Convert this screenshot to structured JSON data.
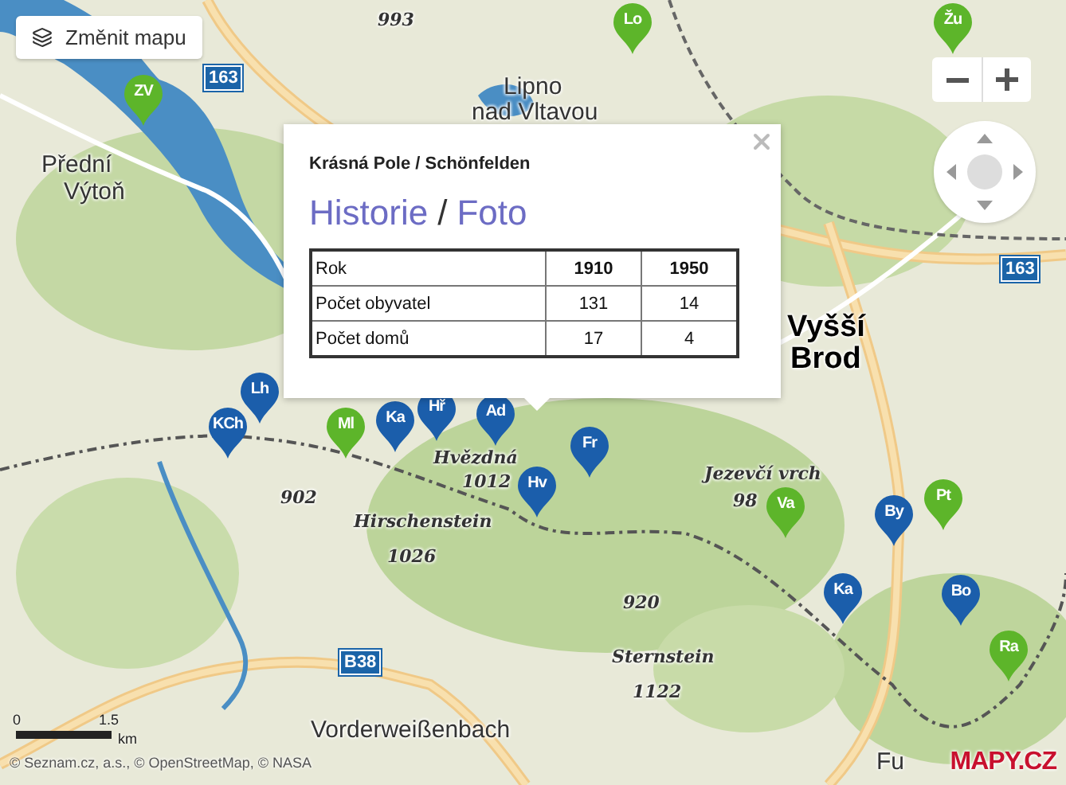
{
  "map_controls": {
    "change_map": "Změnit mapu"
  },
  "popup": {
    "title": "Krásná Pole / Schönfelden",
    "links": [
      "Historie",
      "Foto"
    ],
    "separator": "/",
    "table": {
      "columns": [
        "Rok",
        "1910",
        "1950"
      ],
      "rows": [
        [
          "Počet obyvatel",
          "131",
          "14"
        ],
        [
          "Počet domů",
          "17",
          "4"
        ]
      ]
    }
  },
  "map_labels": [
    {
      "text": "993",
      "kind": "height"
    },
    {
      "text": "Lipno",
      "kind": "town"
    },
    {
      "text": "nad Vltavou",
      "kind": "town"
    },
    {
      "text": "Přední",
      "kind": "town"
    },
    {
      "text": "Výtoň",
      "kind": "town"
    },
    {
      "text": "Vyšší",
      "kind": "city"
    },
    {
      "text": "Brod",
      "kind": "city"
    },
    {
      "text": "Hvězdná",
      "kind": "peak"
    },
    {
      "text": "1012",
      "kind": "height"
    },
    {
      "text": "902",
      "kind": "height"
    },
    {
      "text": "Hirschenstein",
      "kind": "peak"
    },
    {
      "text": "1026",
      "kind": "height"
    },
    {
      "text": "920",
      "kind": "height"
    },
    {
      "text": "Jezevčí vrch",
      "kind": "peak"
    },
    {
      "text": "98",
      "kind": "height"
    },
    {
      "text": "Sternstein",
      "kind": "peak"
    },
    {
      "text": "1122",
      "kind": "height"
    },
    {
      "text": "Vorderweißenbach",
      "kind": "town"
    },
    {
      "text": "Fu",
      "kind": "town"
    }
  ],
  "road_shields": [
    "163",
    "163",
    "B38"
  ],
  "markers": [
    {
      "label": "Lo",
      "color": "#5db52a"
    },
    {
      "label": "Žu",
      "color": "#5db52a"
    },
    {
      "label": "ZV",
      "color": "#5db52a"
    },
    {
      "label": "Lh",
      "color": "#1b5eab"
    },
    {
      "label": "KCh",
      "color": "#1b5eab"
    },
    {
      "label": "Ka",
      "color": "#1b5eab"
    },
    {
      "label": "Hř",
      "color": "#1b5eab"
    },
    {
      "label": "Ml",
      "color": "#5db52a"
    },
    {
      "label": "Ad",
      "color": "#1b5eab"
    },
    {
      "label": "Fr",
      "color": "#1b5eab"
    },
    {
      "label": "Hv",
      "color": "#1b5eab"
    },
    {
      "label": "Va",
      "color": "#5db52a"
    },
    {
      "label": "By",
      "color": "#1b5eab"
    },
    {
      "label": "Pt",
      "color": "#5db52a"
    },
    {
      "label": "Ka",
      "color": "#1b5eab"
    },
    {
      "label": "Bo",
      "color": "#1b5eab"
    },
    {
      "label": "Ra",
      "color": "#5db52a"
    }
  ],
  "scale": {
    "start": "0",
    "end": "1.5",
    "unit": "km"
  },
  "attribution": "© Seznam.cz, a.s., © OpenStreetMap, © NASA",
  "logo": "MAPY.CZ"
}
